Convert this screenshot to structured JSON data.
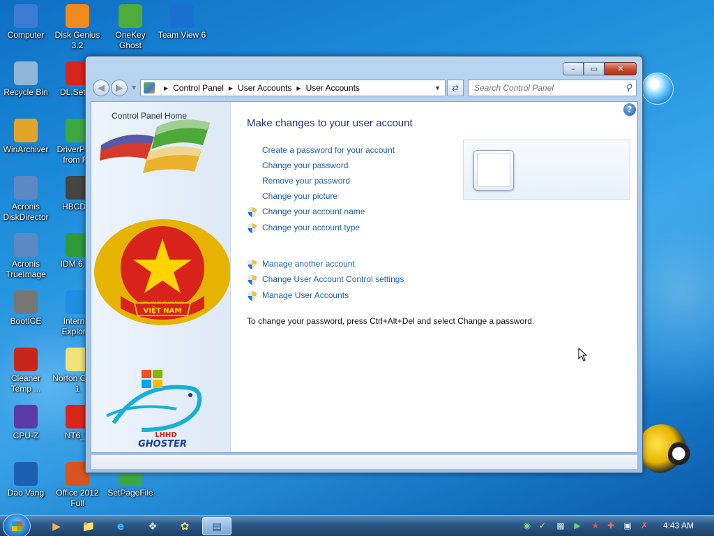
{
  "desktop": {
    "icons": [
      {
        "label": "Computer",
        "icon": "computer-icon",
        "color": "#3b7bd6"
      },
      {
        "label": "Disk Genius 3.2",
        "icon": "disk-genius-icon",
        "color": "#f08a1c"
      },
      {
        "label": "OneKey Ghost",
        "icon": "onekey-ghost-icon",
        "color": "#4fae3a"
      },
      {
        "label": "Team View 6",
        "icon": "teamviewer-icon",
        "color": "#1b6fd1"
      },
      {
        "label": "Recycle Bin",
        "icon": "recycle-bin-icon",
        "color": "#8fb7d9"
      },
      {
        "label": "DL.Setup",
        "icon": "dl-setup-icon",
        "color": "#d8251c"
      },
      {
        "label": "WinArchiver",
        "icon": "winarchiver-icon",
        "color": "#e0a52a"
      },
      {
        "label": "DriverPack from Fo",
        "icon": "driverpack-icon",
        "color": "#3ca842"
      },
      {
        "label": "Acronis DiskDirector",
        "icon": "acronis-diskdirector-icon",
        "color": "#5c89c4"
      },
      {
        "label": "HBCDM",
        "icon": "hbcdm-icon",
        "color": "#444444"
      },
      {
        "label": "Acronis TrueImage",
        "icon": "acronis-trueimage-icon",
        "color": "#5c89c4"
      },
      {
        "label": "IDM 6.12",
        "icon": "idm-icon",
        "color": "#2f9a3b"
      },
      {
        "label": "BootICE",
        "icon": "bootice-icon",
        "color": "#777777"
      },
      {
        "label": "Internet Explorer",
        "icon": "internet-explorer-icon",
        "color": "#1d8ee0"
      },
      {
        "label": "Cleaner Temp ...",
        "icon": "ccleaner-icon",
        "color": "#c7261c"
      },
      {
        "label": "Norton Ghost 1",
        "icon": "norton-ghost-icon",
        "color": "#f2e27a"
      },
      {
        "label": "CPU-Z",
        "icon": "cpu-z-icon",
        "color": "#5b3aa6"
      },
      {
        "label": "NT6_F",
        "icon": "nt6-icon",
        "color": "#d8251c"
      },
      {
        "label": "Dao Vang",
        "icon": "dao-vang-icon",
        "color": "#1d5fb0"
      },
      {
        "label": "Office 2012 Full",
        "icon": "office-icon",
        "color": "#d9531e"
      },
      {
        "label": "SetPageFile",
        "icon": "setpagefile-icon",
        "color": "#3ca842"
      }
    ]
  },
  "window": {
    "address": {
      "crumbs": [
        "Control Panel",
        "User Accounts",
        "User Accounts"
      ]
    },
    "search": {
      "placeholder": "Search Control Panel"
    },
    "sidebar": {
      "home_link": "Control Panel Home",
      "emblem_text": "VIỆT NAM",
      "emblem_ring_text": "CỘNG HÒA XÃ HỘI CHỦ NGHĨA",
      "logo_text_top": "LHHD",
      "logo_text_bottom": "GHOSTER"
    },
    "main": {
      "title": "Make changes to your user account",
      "links_group1": [
        {
          "label": "Create a password for your account",
          "shield": false
        },
        {
          "label": "Change your password",
          "shield": false
        },
        {
          "label": "Remove your password",
          "shield": false
        },
        {
          "label": "Change your picture",
          "shield": false
        },
        {
          "label": "Change your account name",
          "shield": true
        },
        {
          "label": "Change your account type",
          "shield": true
        }
      ],
      "links_group2": [
        {
          "label": "Manage another account",
          "shield": true
        },
        {
          "label": "Change User Account Control settings",
          "shield": true
        },
        {
          "label": "Manage User Accounts",
          "shield": true
        }
      ],
      "note": "To change your password, press Ctrl+Alt+Del and select Change a password."
    }
  },
  "taskbar": {
    "pinned": [
      "media-player-icon",
      "explorer-icon",
      "internet-explorer-icon",
      "paint-icon",
      "ghost-icon",
      "control-panel-icon"
    ],
    "clock": "4:43 AM"
  }
}
